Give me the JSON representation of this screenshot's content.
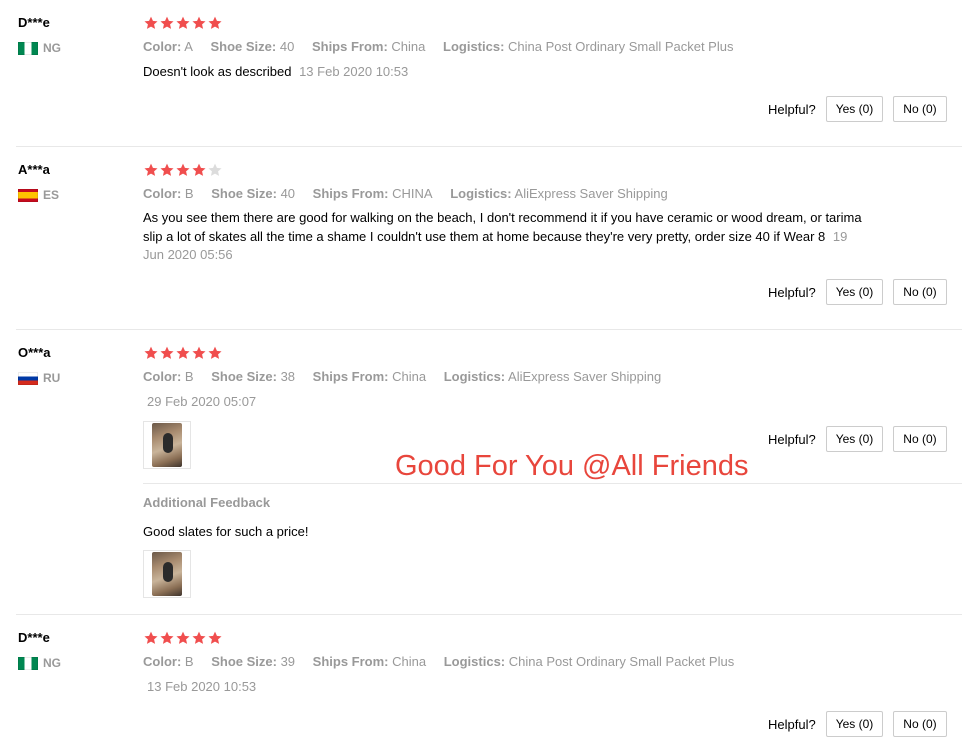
{
  "helpful_label": "Helpful?",
  "watermark": "Good For You @All Friends",
  "labels": {
    "color": "Color:",
    "shoe_size": "Shoe Size:",
    "ships_from": "Ships From:",
    "logistics": "Logistics:"
  },
  "colors": {
    "star_filled": "#f04e4e",
    "star_empty": "#dcdcdc",
    "watermark": "#e8463c"
  },
  "reviews": [
    {
      "user": "D***e",
      "country": "NG",
      "rating": 5,
      "color": "A",
      "shoe_size": "40",
      "ships_from": "China",
      "logistics": "China Post Ordinary Small Packet Plus",
      "text": "Doesn't look as described",
      "date": "13 Feb 2020 10:53",
      "yes": "Yes (0)",
      "no": "No (0)"
    },
    {
      "user": "A***a",
      "country": "ES",
      "rating": 4,
      "color": "B",
      "shoe_size": "40",
      "ships_from": "CHINA",
      "logistics": "AliExpress Saver Shipping",
      "text": "As you see them there are good for walking on the beach, I don't recommend it if you have ceramic or wood dream, or tarima slip a lot of skates all the time a shame I couldn't use them at home because they're very pretty, order size 40 if Wear 8",
      "date": "19 Jun 2020 05:56",
      "yes": "Yes (0)",
      "no": "No (0)"
    },
    {
      "user": "O***a",
      "country": "RU",
      "rating": 5,
      "color": "B",
      "shoe_size": "38",
      "ships_from": "China",
      "logistics": "AliExpress Saver Shipping",
      "text": "",
      "date": "29 Feb 2020 05:07",
      "yes": "Yes (0)",
      "no": "No (0)",
      "additional_label": "Additional Feedback",
      "additional_text": "Good slates for such a price!"
    },
    {
      "user": "D***e",
      "country": "NG",
      "rating": 5,
      "color": "B",
      "shoe_size": "39",
      "ships_from": "China",
      "logistics": "China Post Ordinary Small Packet Plus",
      "text": "",
      "date": "13 Feb 2020 10:53",
      "yes": "Yes (0)",
      "no": "No (0)"
    }
  ]
}
